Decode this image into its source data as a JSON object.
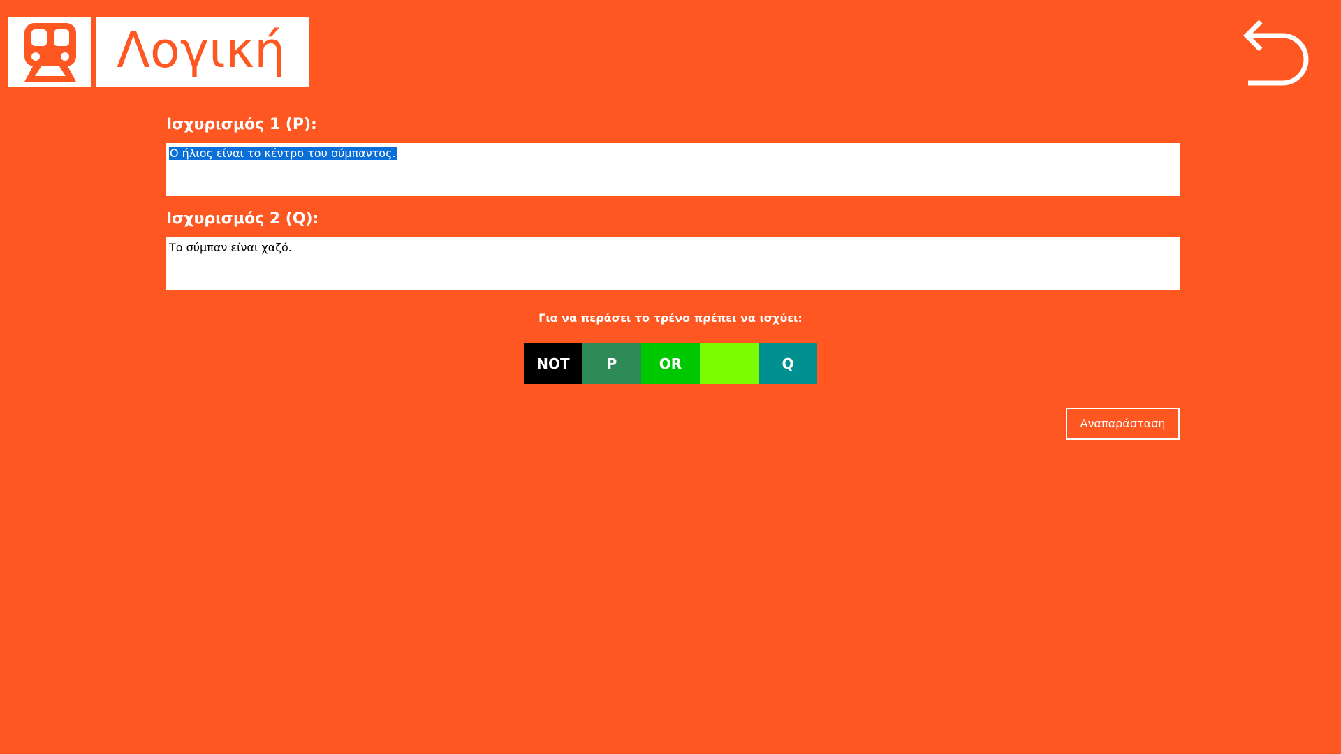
{
  "colors": {
    "background": "#FF5722",
    "panel": "#FFFFFF",
    "selection": "#0A6FD8"
  },
  "header": {
    "icon": "train-icon",
    "title": "Λογική",
    "back_icon": "undo-arrow-icon"
  },
  "statement_p": {
    "label": "Ισχυρισμός 1 (P):",
    "value": "Ο ήλιος είναι το κέντρο του σύμπαντος."
  },
  "statement_q": {
    "label": "Ισχυρισμός 2 (Q):",
    "value": "Το σύμπαν είναι χαζό."
  },
  "rule": {
    "caption": "Για να περάσει το τρένο πρέπει να ισχύει:",
    "tiles": [
      {
        "label": "NOT",
        "color": "#000000"
      },
      {
        "label": "P",
        "color": "#2E8B57"
      },
      {
        "label": "OR",
        "color": "#00C800"
      },
      {
        "label": "",
        "color": "#7CFC00"
      },
      {
        "label": "Q",
        "color": "#009090"
      }
    ]
  },
  "actions": {
    "render_label": "Αναπαράσταση"
  }
}
